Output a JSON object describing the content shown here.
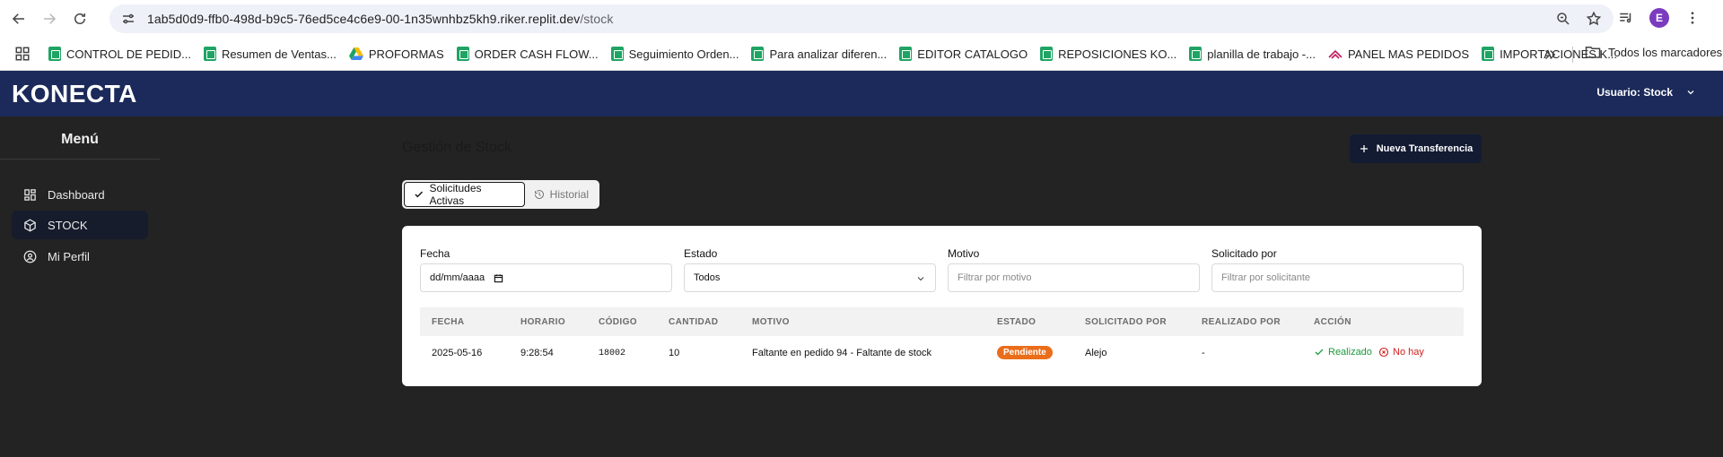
{
  "browser": {
    "url_host": "1ab5d0d9-ffb0-498d-b9c5-76ed5ce4c6e9-00-1n35wnhbz5kh9.riker.replit.dev",
    "url_path": "/stock",
    "profile_initial": "E",
    "bookmarks": [
      {
        "label": "CONTROL DE PEDID...",
        "icon": "sheets-icon"
      },
      {
        "label": "Resumen de Ventas...",
        "icon": "sheets-icon"
      },
      {
        "label": "PROFORMAS",
        "icon": "drive-icon"
      },
      {
        "label": "ORDER CASH FLOW...",
        "icon": "sheets-icon"
      },
      {
        "label": "Seguimiento Orden...",
        "icon": "sheets-icon"
      },
      {
        "label": "Para analizar diferen...",
        "icon": "sheets-icon"
      },
      {
        "label": "EDITOR CATALOGO",
        "icon": "sheets-icon"
      },
      {
        "label": "REPOSICIONES KO...",
        "icon": "sheets-icon"
      },
      {
        "label": "planilla de trabajo -...",
        "icon": "sheets-icon"
      },
      {
        "label": "PANEL MAS PEDIDOS",
        "icon": "panel-icon"
      },
      {
        "label": "IMPORTACIONES K...",
        "icon": "sheets-icon"
      }
    ],
    "all_bookmarks_label": "Todos los marcadores"
  },
  "header": {
    "logo": "KONECTA",
    "user_label": "Usuario: Stock"
  },
  "sidebar": {
    "title": "Menú",
    "items": [
      {
        "label": "Dashboard",
        "icon": "dashboard-icon"
      },
      {
        "label": "STOCK",
        "icon": "box-icon"
      },
      {
        "label": "Mi Perfil",
        "icon": "user-circle-icon"
      }
    ]
  },
  "main": {
    "title": "Gestión de Stock",
    "new_button": "Nueva Transferencia",
    "tabs": [
      {
        "label": "Solicitudes Activas",
        "icon": "check-icon"
      },
      {
        "label": "Historial",
        "icon": "history-icon"
      }
    ],
    "filters": {
      "fecha": {
        "label": "Fecha",
        "value": "dd/mm/aaaa"
      },
      "estado": {
        "label": "Estado",
        "value": "Todos"
      },
      "motivo": {
        "label": "Motivo",
        "placeholder": "Filtrar por motivo"
      },
      "solicitado": {
        "label": "Solicitado por",
        "placeholder": "Filtrar por solicitante"
      }
    },
    "table": {
      "columns": [
        "FECHA",
        "HORARIO",
        "CÓDIGO",
        "CANTIDAD",
        "MOTIVO",
        "ESTADO",
        "SOLICITADO POR",
        "REALIZADO POR",
        "ACCIÓN"
      ],
      "rows": [
        {
          "fecha": "2025-05-16",
          "horario": "9:28:54",
          "codigo": "18002",
          "cantidad": "10",
          "motivo": "Faltante en pedido 94 - Faltante de stock",
          "estado": "Pendiente",
          "solicitado": "Alejo",
          "realizado": "-",
          "accion_ok": "Realizado",
          "accion_no": "No hay"
        }
      ]
    }
  },
  "colors": {
    "header_bg": "#1b2a5a",
    "status_pending": "#ea6d1a",
    "action_ok": "#1b9a3a",
    "action_no": "#d11d1d"
  }
}
